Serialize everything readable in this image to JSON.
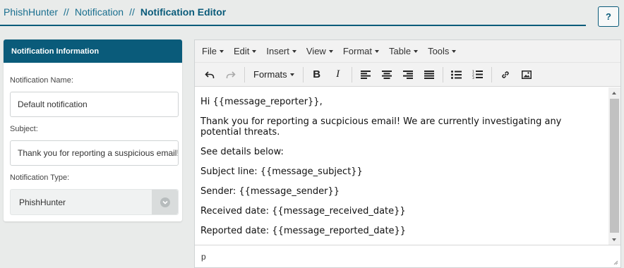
{
  "breadcrumb": {
    "items": [
      "PhishHunter",
      "Notification"
    ],
    "separator": "//",
    "current": "Notification Editor"
  },
  "help_button": {
    "label": "?"
  },
  "info_panel": {
    "title": "Notification Information",
    "name_label": "Notification Name:",
    "name_value": "Default notification",
    "subject_label": "Subject:",
    "subject_value": "Thank you for reporting a suspicious email!",
    "type_label": "Notification Type:",
    "type_value": "PhishHunter"
  },
  "editor": {
    "menu": [
      "File",
      "Edit",
      "Insert",
      "View",
      "Format",
      "Table",
      "Tools"
    ],
    "formats_label": "Formats",
    "toolbar_icons": [
      "undo-icon",
      "redo-icon",
      "bold-icon",
      "italic-icon",
      "align-left-icon",
      "align-center-icon",
      "align-right-icon",
      "align-justify-icon",
      "bullet-list-icon",
      "numbered-list-icon",
      "link-icon",
      "image-icon"
    ],
    "bold_label": "B",
    "italic_label": "I",
    "content": [
      "Hi {{message_reporter}},",
      "Thank you for reporting a sucpicious email! We are currently investigating any potential threats.",
      "See details below:",
      "Subject line: {{message_subject}}",
      "Sender: {{message_sender}}",
      "Received date: {{message_received_date}}",
      "Reported date: {{message_reported_date}}"
    ],
    "status_path": "p"
  },
  "colors": {
    "accent": "#0a5b7a",
    "background": "#e9ebea"
  }
}
